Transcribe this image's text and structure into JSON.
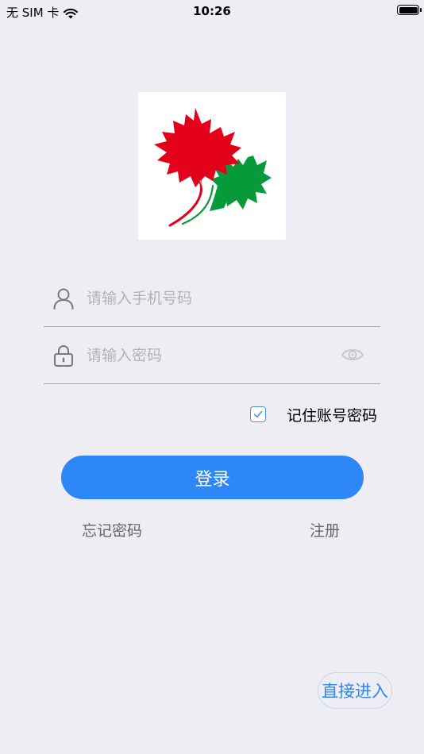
{
  "status_bar": {
    "carrier": "无 SIM 卡",
    "time": "10:26"
  },
  "login_form": {
    "phone_placeholder": "请输入手机号码",
    "phone_value": "",
    "password_placeholder": "请输入密码",
    "password_value": "",
    "remember_label": "记住账号密码",
    "remember_checked": true,
    "login_label": "登录"
  },
  "links": {
    "forgot_password": "忘记密码",
    "register": "注册"
  },
  "guest_entry_label": "直接进入",
  "colors": {
    "background": "#EEEDF3",
    "primary": "#2E87F6",
    "checkbox": "#4A90E2",
    "leaf_red": "#E4001B",
    "leaf_green": "#069A3B"
  },
  "icons": {
    "phone_field": "user-icon",
    "password_field": "lock-icon",
    "password_toggle": "eye-icon",
    "remember": "checkbox-checked-icon",
    "logo": "maple-leaf-logo"
  }
}
